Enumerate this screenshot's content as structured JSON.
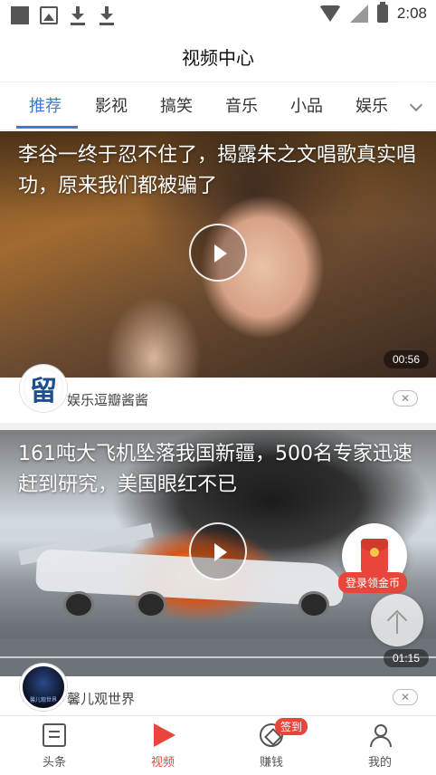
{
  "status_bar": {
    "time": "2:08"
  },
  "header": {
    "title": "视频中心"
  },
  "tabs": [
    {
      "label": "推荐",
      "active": true
    },
    {
      "label": "影视"
    },
    {
      "label": "搞笑"
    },
    {
      "label": "音乐"
    },
    {
      "label": "小品"
    },
    {
      "label": "娱乐"
    }
  ],
  "feed": [
    {
      "title": "李谷一终于忍不住了，揭露朱之文唱歌真实唱功，原来我们都被骗了",
      "duration": "00:56",
      "author": "娱乐逗瓣酱酱",
      "avatar_text": "留"
    },
    {
      "title": "161吨大飞机坠落我国新疆，500名专家迅速赶到研究，美国眼红不已",
      "duration": "01:15",
      "author": "馨儿观世界",
      "avatar_text": "馨儿观世界"
    }
  ],
  "widgets": {
    "coin_label": "登录领金币"
  },
  "bottom_nav": [
    {
      "label": "头条",
      "icon": "news-icon"
    },
    {
      "label": "视频",
      "icon": "video-play-icon",
      "active": true
    },
    {
      "label": "赚钱",
      "icon": "money-icon",
      "badge": "签到"
    },
    {
      "label": "我的",
      "icon": "user-icon"
    }
  ],
  "colors": {
    "accent": "#3a7bd5",
    "brand_red": "#e8463b"
  }
}
